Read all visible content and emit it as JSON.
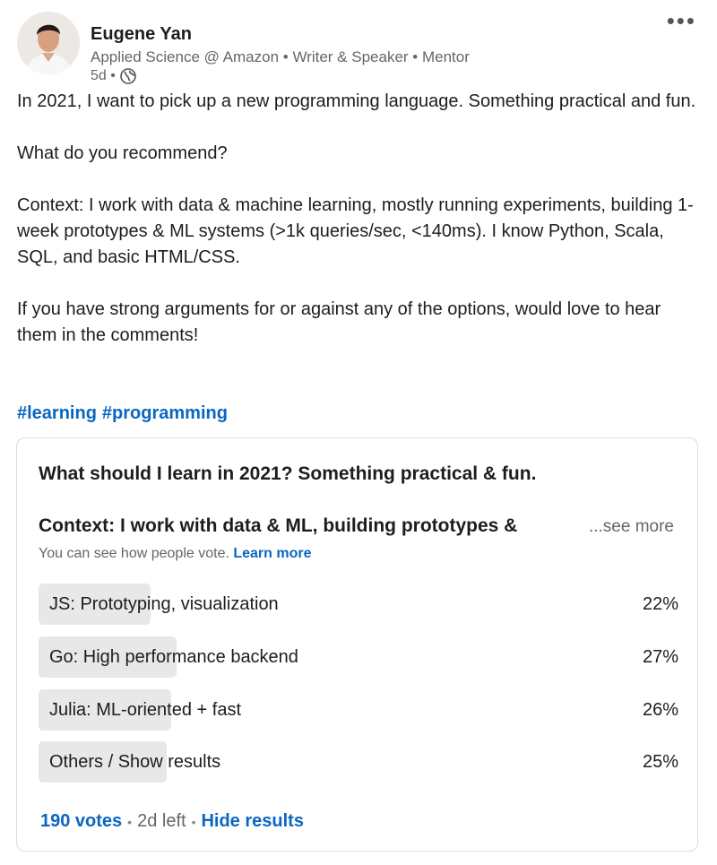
{
  "author": {
    "name": "Eugene Yan",
    "headline": "Applied Science @ Amazon • Writer & Speaker • Mentor",
    "time": "5d •",
    "visibility_icon": "globe-icon"
  },
  "menu_icon": "more-horizontal-icon",
  "post": {
    "paragraphs": [
      "In 2021, I want to pick up a new programming language. Something practical and fun.",
      "What do you recommend?",
      "Context: I work with data & machine learning, mostly running experiments, building 1-week prototypes & ML systems (>1k queries/sec, <140ms). I know Python, Scala, SQL, and basic HTML/CSS.",
      "If you have strong arguments for or against any of the options, would love to hear them in the comments!"
    ],
    "hashtags": [
      "#learning",
      "#programming"
    ]
  },
  "poll": {
    "question": "What should I learn in 2021? Something practical & fun.",
    "context_text": "Context: I work with data & ML, building prototypes &",
    "see_more": "...see more",
    "visibility_note": "You can see how people vote.",
    "learn_more": "Learn more",
    "options": [
      {
        "label": "JS: Prototyping, visualization",
        "percent_text": "22%",
        "percent": 22
      },
      {
        "label": "Go: High performance backend",
        "percent_text": "27%",
        "percent": 27
      },
      {
        "label": "Julia: ML-oriented + fast",
        "percent_text": "26%",
        "percent": 26
      },
      {
        "label": "Others / Show results",
        "percent_text": "25%",
        "percent": 25
      }
    ],
    "votes": "190 votes",
    "time_left": "2d left",
    "hide_results": "Hide results"
  },
  "colors": {
    "link": "#0a66c2",
    "bar_fill": "#e8e8e8",
    "border": "#dcdcdc"
  }
}
